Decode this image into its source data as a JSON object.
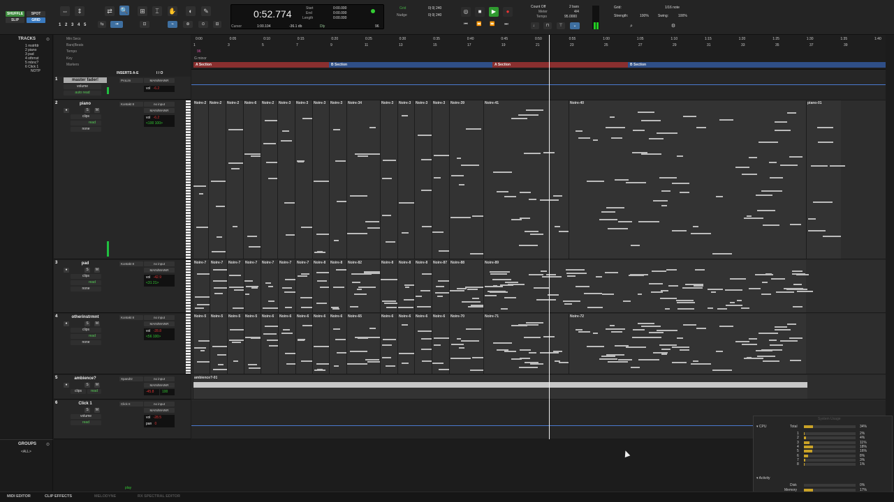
{
  "modes": {
    "shuffle": "SHUFFLE",
    "spot": "SPOT",
    "slip": "SLIP",
    "grid": "GRID"
  },
  "num_buttons": [
    "1",
    "2",
    "3",
    "4",
    "5"
  ],
  "counter": {
    "main": "0:52.774",
    "start_label": "Start",
    "end_label": "End",
    "length_label": "Length",
    "start": "0:00.000",
    "end": "0:00.000",
    "length": "0:00.000",
    "cursor_label": "Cursor",
    "cursor": "1:00.104",
    "level": "-36.1 db",
    "dly": "Dly",
    "tempo": "96"
  },
  "grid": {
    "grid_label": "Grid",
    "grid_value": "0| 0| 240",
    "nudge_label": "Nudge",
    "nudge_value": "0| 0| 240"
  },
  "countoff": {
    "label": "Count Off",
    "value": "2 bars",
    "meter_label": "Meter",
    "meter": "4/4",
    "tempo_label": "Tempo",
    "tempo": "95.0000"
  },
  "grid_right": {
    "grid": "Grid:",
    "note": "1/16 note",
    "strength_label": "Strength:",
    "strength": "100%",
    "swing_label": "Swing:",
    "swing": "100%"
  },
  "tracks_panel": {
    "title": "TRACKS",
    "items": [
      "1 mstrfdr",
      "2 piano",
      "3 pad",
      "4 othrnst",
      "5 mbnc?",
      "6 Click 1",
      "NOTP"
    ]
  },
  "groups_panel": {
    "title": "GROUPS",
    "all": "<ALL>"
  },
  "ruler_labels": [
    "Min:Secs",
    "Bars|Beats",
    "Tempo",
    "Key",
    "Markers"
  ],
  "ruler_extra": {
    "tempo": "96",
    "key": "G minor"
  },
  "time_ticks": [
    "0:00",
    "0:05",
    "0:10",
    "0:15",
    "0:20",
    "0:25",
    "0:30",
    "0:35",
    "0:40",
    "0:45",
    "0:50",
    "0:55",
    "1:00",
    "1:05",
    "1:10",
    "1:15",
    "1:20",
    "1:25",
    "1:30",
    "1:35",
    "1:40"
  ],
  "bar_ticks": [
    "1",
    "3",
    "5",
    "7",
    "9",
    "11",
    "13",
    "15",
    "17",
    "19",
    "21",
    "23",
    "25",
    "27",
    "29",
    "31",
    "33",
    "35",
    "37",
    "39"
  ],
  "markers": [
    {
      "name": "A Section",
      "color": "#b33a3a"
    },
    {
      "name": "B Section",
      "color": "#3a5fa0"
    },
    {
      "name": "A Section",
      "color": "#b33a3a"
    },
    {
      "name": "B Section",
      "color": "#3a5fa0"
    }
  ],
  "headers": {
    "inserts": "INSERTS A-E",
    "io": "I / O"
  },
  "tracks": [
    {
      "num": "1",
      "name": "master fader!",
      "insert": "ProLim",
      "io": "MAIN/MAINR",
      "view": "volume",
      "auto": "auto read",
      "vol_label": "vol",
      "vol": "-6.2"
    },
    {
      "num": "2",
      "name": "piano",
      "insert": "Kontakt 8",
      "io_in": "no input",
      "io": "MAIN/MAINR",
      "view": "clips",
      "dyn": "dyn",
      "read": "read",
      "none": "none",
      "vol_label": "vol",
      "vol": "-6.2",
      "pan": "<100  100>"
    },
    {
      "num": "3",
      "name": "pad",
      "insert": "Kontakt 8",
      "io_in": "no input",
      "io": "MAIN/MAINR",
      "view": "clips",
      "dyn": "dyn",
      "read": "read",
      "none": "none",
      "vol_label": "vol",
      "vol": "-42.9",
      "pan": "<31  21>"
    },
    {
      "num": "4",
      "name": "otherinstrmnt",
      "insert": "Kontakt 8",
      "io_in": "no input",
      "io": "MAIN/MAINR",
      "view": "clips",
      "dyn": "dyn",
      "read": "read",
      "none": "none",
      "vol_label": "vol",
      "vol": "-28.8",
      "pan": "<56  100>"
    },
    {
      "num": "5",
      "name": "ambience?",
      "insert": "Xpand!2",
      "io_in": "no input",
      "io": "MAIN/MAINR",
      "view": "clips",
      "read": "read",
      "vol": "-45.8",
      "pan": "100"
    },
    {
      "num": "6",
      "name": "Click 1",
      "insert": "Click II",
      "io_in": "no input",
      "io": "MAIN/MAINR",
      "view": "volume",
      "read": "read",
      "vol_label": "vol",
      "vol": "-28.5",
      "pan_label": "pan",
      "pan": "0"
    }
  ],
  "clips": {
    "piano": [
      "Noire-2",
      "Noire-2",
      "Noire-2",
      "Noire-6",
      "Noire-2",
      "Noire-3",
      "Noire-3",
      "Noire-3",
      "Noire-3",
      "Noire-34",
      "Noire-3",
      "Noire-3",
      "Noire-3",
      "Noire-3",
      "Noire-39",
      "Noire-41",
      "Noire-40",
      "piano-01"
    ],
    "pad": [
      "Noire-7",
      "Noire-7",
      "Noire-7",
      "Noire-7",
      "Noire-7",
      "Noire-7",
      "Noire-7",
      "Noire-8",
      "Noire-8",
      "Noire-82",
      "Noire-8",
      "Noire-8",
      "Noire-8",
      "Noire-87",
      "Noire-88",
      "Noire-89"
    ],
    "other": [
      "Noire-5",
      "Noire-5",
      "Noire-5",
      "Noire-5",
      "Noire-6",
      "Noire-6",
      "Noire-6",
      "Noire-6",
      "Noire-6",
      "Noire-65",
      "Noire-6",
      "Noire-6",
      "Noire-6",
      "Noire-6",
      "Noire-70",
      "Noire-71",
      "Noire-72"
    ],
    "ambience": "ambience?-01"
  },
  "system": {
    "title": "System Usage",
    "cpu": "CPU",
    "total": "Total",
    "total_pct": "34%",
    "cores": [
      {
        "n": "1",
        "pct": "2%"
      },
      {
        "n": "2",
        "pct": "4%"
      },
      {
        "n": "3",
        "pct": "11%"
      },
      {
        "n": "4",
        "pct": "18%"
      },
      {
        "n": "5",
        "pct": "16%"
      },
      {
        "n": "6",
        "pct": "8%"
      },
      {
        "n": "7",
        "pct": "3%"
      },
      {
        "n": "8",
        "pct": "1%"
      }
    ],
    "activity": "Activity",
    "disk": "Disk",
    "disk_pct": "0%",
    "memory": "Memory",
    "memory_pct": "17%"
  },
  "bottom": {
    "midi": "MIDI EDITOR",
    "clip": "CLIP EFFECTS",
    "melodyne": "MELODYNE",
    "rx": "RX SPECTRAL EDITOR"
  },
  "play": "play"
}
